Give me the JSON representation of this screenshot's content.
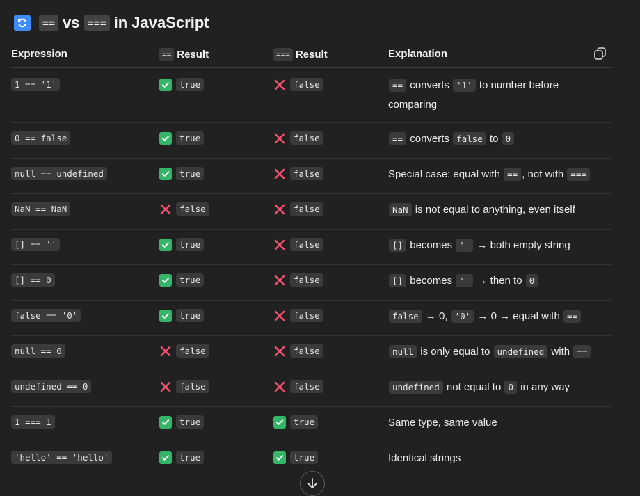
{
  "title": {
    "emoji": "refresh-emoji",
    "code1": "==",
    "mid": "vs",
    "code2": "===",
    "suffix": "in JavaScript"
  },
  "header": {
    "expression": "Expression",
    "loose_code": "==",
    "loose_label": "Result",
    "strict_code": "===",
    "strict_label": "Result",
    "explanation": "Explanation"
  },
  "rows": [
    {
      "expr": "1 == '1'",
      "loose": "true",
      "strict": "false",
      "expl": [
        {
          "t": "code",
          "v": "=="
        },
        {
          "t": "text",
          "v": " converts "
        },
        {
          "t": "code",
          "v": "'1'"
        },
        {
          "t": "text",
          "v": " to number before comparing"
        }
      ]
    },
    {
      "expr": "0 == false",
      "loose": "true",
      "strict": "false",
      "expl": [
        {
          "t": "code",
          "v": "=="
        },
        {
          "t": "text",
          "v": " converts "
        },
        {
          "t": "code",
          "v": "false"
        },
        {
          "t": "text",
          "v": " to "
        },
        {
          "t": "code",
          "v": "0"
        }
      ]
    },
    {
      "expr": "null == undefined",
      "loose": "true",
      "strict": "false",
      "expl": [
        {
          "t": "text",
          "v": "Special case: equal with "
        },
        {
          "t": "code",
          "v": "=="
        },
        {
          "t": "text",
          "v": ", not with "
        },
        {
          "t": "code",
          "v": "==="
        }
      ]
    },
    {
      "expr": "NaN == NaN",
      "loose": "false",
      "strict": "false",
      "expl": [
        {
          "t": "code",
          "v": "NaN"
        },
        {
          "t": "text",
          "v": " is not equal to anything, even itself"
        }
      ]
    },
    {
      "expr": "[] == ''",
      "loose": "true",
      "strict": "false",
      "expl": [
        {
          "t": "code",
          "v": "[]"
        },
        {
          "t": "text",
          "v": " becomes "
        },
        {
          "t": "code",
          "v": "''"
        },
        {
          "t": "text",
          "v": " → both empty string"
        }
      ]
    },
    {
      "expr": "[] == 0",
      "loose": "true",
      "strict": "false",
      "expl": [
        {
          "t": "code",
          "v": "[]"
        },
        {
          "t": "text",
          "v": " becomes "
        },
        {
          "t": "code",
          "v": "''"
        },
        {
          "t": "text",
          "v": " → then to "
        },
        {
          "t": "code",
          "v": "0"
        }
      ]
    },
    {
      "expr": "false == '0'",
      "loose": "true",
      "strict": "false",
      "expl": [
        {
          "t": "code",
          "v": "false"
        },
        {
          "t": "text",
          "v": " → 0, "
        },
        {
          "t": "code",
          "v": "'0'"
        },
        {
          "t": "text",
          "v": " → 0 → equal with "
        },
        {
          "t": "code",
          "v": "=="
        }
      ]
    },
    {
      "expr": "null == 0",
      "loose": "false",
      "strict": "false",
      "expl": [
        {
          "t": "code",
          "v": "null"
        },
        {
          "t": "text",
          "v": " is only equal to "
        },
        {
          "t": "code",
          "v": "undefined"
        },
        {
          "t": "text",
          "v": " with "
        },
        {
          "t": "code",
          "v": "=="
        }
      ]
    },
    {
      "expr": "undefined == 0",
      "loose": "false",
      "strict": "false",
      "expl": [
        {
          "t": "code",
          "v": "undefined"
        },
        {
          "t": "text",
          "v": " not equal to "
        },
        {
          "t": "code",
          "v": "0"
        },
        {
          "t": "text",
          "v": " in any way"
        }
      ]
    },
    {
      "expr": "1 === 1",
      "loose": "true",
      "strict": "true",
      "expl": [
        {
          "t": "text",
          "v": "Same type, same value"
        }
      ]
    },
    {
      "expr": "'hello' == 'hello'",
      "loose": "true",
      "strict": "true",
      "expl": [
        {
          "t": "text",
          "v": "Identical strings"
        }
      ]
    }
  ],
  "icons": {
    "true_icon": "check-mark-icon",
    "false_icon": "cross-mark-icon",
    "copy": "copy-icon",
    "scroll": "arrow-down-icon"
  },
  "colors": {
    "background": "#212121",
    "check": "#35b567",
    "cross": "#f0506e",
    "code_bg": "#3a3a3a"
  }
}
